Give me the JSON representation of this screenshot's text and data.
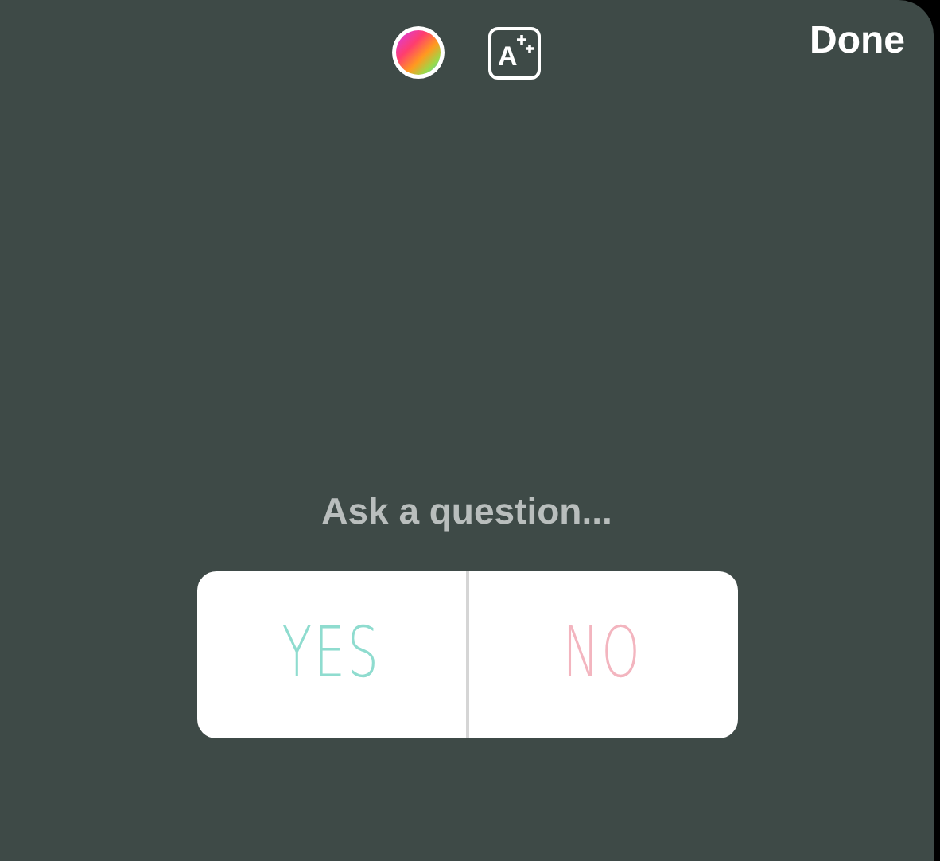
{
  "toolbar": {
    "text_style_label": "A",
    "done": "Done"
  },
  "question": {
    "placeholder": "Ask a question..."
  },
  "answers": [
    {
      "label": "YES",
      "color": "#8fdccf"
    },
    {
      "label": "NO",
      "color": "#f3b5bf"
    }
  ]
}
